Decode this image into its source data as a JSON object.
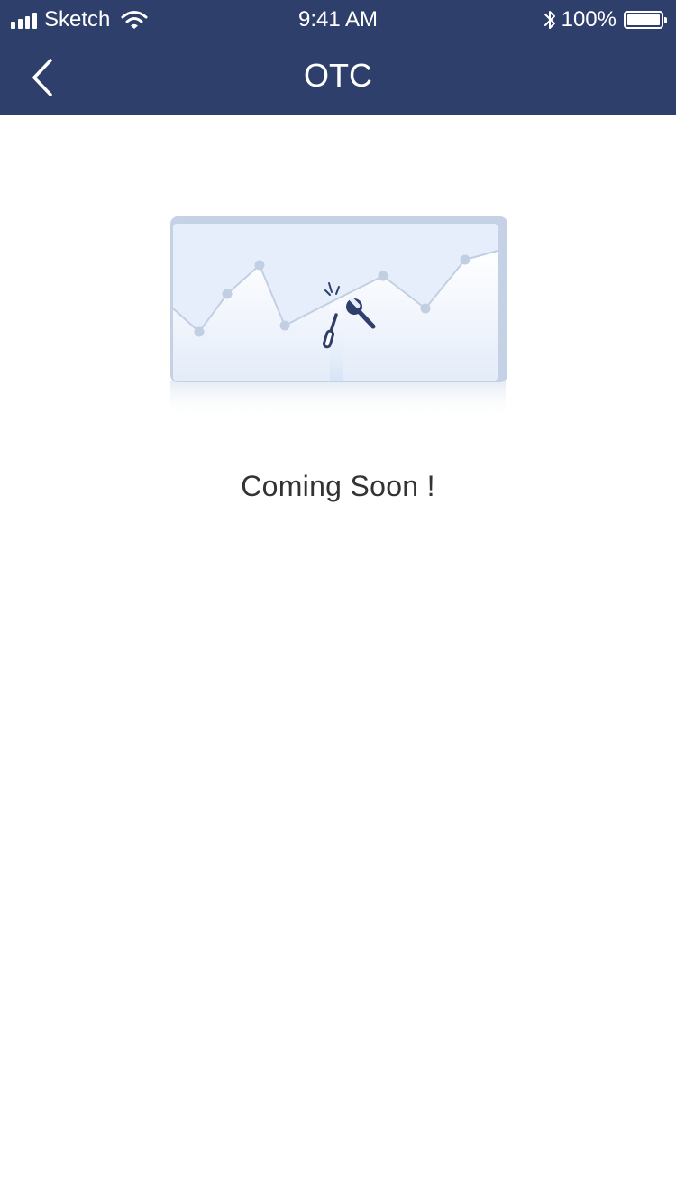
{
  "status_bar": {
    "carrier": "Sketch",
    "time": "9:41 AM",
    "battery_percent_text": "100%",
    "battery_level": 1.0,
    "icons": [
      "signal-icon",
      "wifi-icon",
      "bluetooth-icon",
      "battery-icon"
    ]
  },
  "nav": {
    "title": "OTC",
    "back_icon": "chevron-left-icon"
  },
  "main": {
    "illustration_icon": "maintenance-chart-illustration",
    "message": "Coming Soon !"
  },
  "colors": {
    "nav_background": "#2f3f6b",
    "text": "#333333",
    "illustration_frame": "#c5d2e6",
    "illustration_panel": "#e6eefb",
    "tool_color": "#2f3f6b"
  }
}
